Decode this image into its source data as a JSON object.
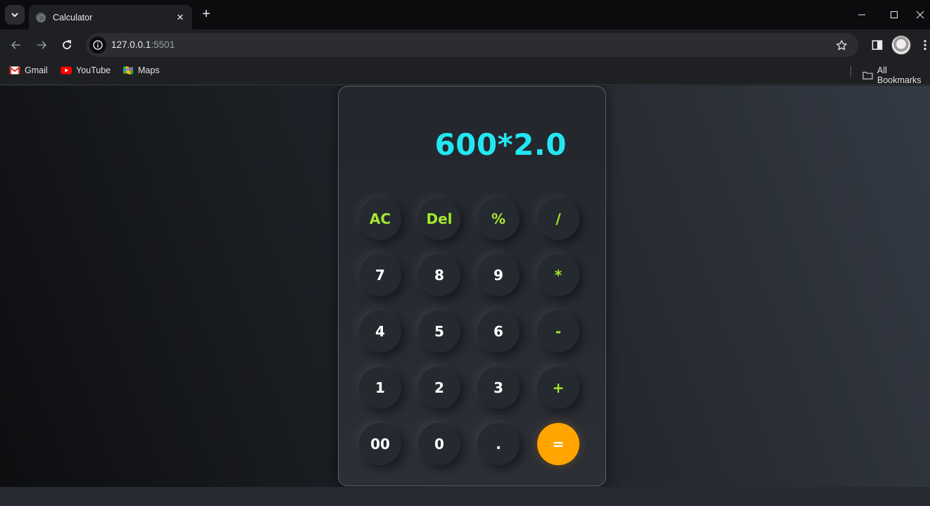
{
  "browser": {
    "tab_title": "Calculator",
    "url_host": "127.0.0.1",
    "url_port": ":5501",
    "bookmarks": [
      {
        "label": "Gmail",
        "icon": "gmail-icon"
      },
      {
        "label": "YouTube",
        "icon": "youtube-icon"
      },
      {
        "label": "Maps",
        "icon": "maps-icon"
      }
    ],
    "all_bookmarks_label": "All Bookmarks"
  },
  "calculator": {
    "display": "600*2.0",
    "keys": [
      {
        "label": "AC",
        "kind": "op",
        "name": "ac-button"
      },
      {
        "label": "Del",
        "kind": "op",
        "name": "delete-button"
      },
      {
        "label": "%",
        "kind": "op",
        "name": "percent-button"
      },
      {
        "label": "/",
        "kind": "op",
        "name": "divide-button"
      },
      {
        "label": "7",
        "kind": "num",
        "name": "digit-7-button"
      },
      {
        "label": "8",
        "kind": "num",
        "name": "digit-8-button"
      },
      {
        "label": "9",
        "kind": "num",
        "name": "digit-9-button"
      },
      {
        "label": "*",
        "kind": "op",
        "name": "multiply-button"
      },
      {
        "label": "4",
        "kind": "num",
        "name": "digit-4-button"
      },
      {
        "label": "5",
        "kind": "num",
        "name": "digit-5-button"
      },
      {
        "label": "6",
        "kind": "num",
        "name": "digit-6-button"
      },
      {
        "label": "-",
        "kind": "op",
        "name": "subtract-button"
      },
      {
        "label": "1",
        "kind": "num",
        "name": "digit-1-button"
      },
      {
        "label": "2",
        "kind": "num",
        "name": "digit-2-button"
      },
      {
        "label": "3",
        "kind": "num",
        "name": "digit-3-button"
      },
      {
        "label": "+",
        "kind": "op",
        "name": "add-button"
      },
      {
        "label": "00",
        "kind": "num",
        "name": "double-zero-button"
      },
      {
        "label": "0",
        "kind": "num",
        "name": "digit-0-button"
      },
      {
        "label": ".",
        "kind": "num",
        "name": "decimal-button"
      },
      {
        "label": "=",
        "kind": "eq",
        "name": "equals-button"
      }
    ],
    "colors": {
      "display": "#22e6f2",
      "operator": "#a4e82c",
      "equals": "#ffa401"
    }
  }
}
